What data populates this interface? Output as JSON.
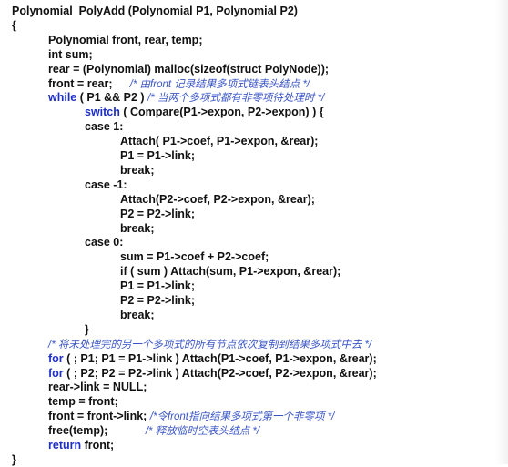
{
  "document": {
    "lines": [
      {
        "indent": 0,
        "parts": [
          {
            "text": "Polynomial  PolyAdd (Polynomial P1, Polynomial P2)",
            "kind": "code"
          }
        ]
      },
      {
        "indent": 0,
        "parts": [
          {
            "text": "{",
            "kind": "code"
          }
        ]
      },
      {
        "indent": 1,
        "parts": [
          {
            "text": "Polynomial front, rear, temp;",
            "kind": "code"
          }
        ]
      },
      {
        "indent": 1,
        "parts": [
          {
            "text": "int sum;",
            "kind": "code"
          }
        ]
      },
      {
        "indent": 1,
        "parts": [
          {
            "text": "rear = (Polynomial) malloc(sizeof(struct PolyNode));",
            "kind": "code"
          }
        ]
      },
      {
        "indent": 1,
        "parts": [
          {
            "text": "front = rear;",
            "kind": "code"
          },
          {
            "text": "      /* 由front 记录结果多项式链表头结点 */",
            "kind": "comment"
          }
        ]
      },
      {
        "indent": 1,
        "parts": [
          {
            "text": "while",
            "kind": "keyword"
          },
          {
            "text": " ( P1 && P2 ) ",
            "kind": "code"
          },
          {
            "text": "/* 当两个多项式都有非零项待处理时 */",
            "kind": "comment"
          }
        ]
      },
      {
        "indent": 2,
        "parts": [
          {
            "text": "switch",
            "kind": "keyword"
          },
          {
            "text": " ( Compare(P1->expon, P2->expon) ) {",
            "kind": "code"
          }
        ]
      },
      {
        "indent": 2,
        "parts": [
          {
            "text": "case 1:",
            "kind": "code"
          }
        ]
      },
      {
        "indent": 3,
        "parts": [
          {
            "text": "Attach( P1->coef, P1->expon, &rear);",
            "kind": "code"
          }
        ]
      },
      {
        "indent": 3,
        "parts": [
          {
            "text": "P1 = P1->link;",
            "kind": "code"
          }
        ]
      },
      {
        "indent": 3,
        "parts": [
          {
            "text": "break;",
            "kind": "code"
          }
        ]
      },
      {
        "indent": 2,
        "parts": [
          {
            "text": "case -1:",
            "kind": "code"
          }
        ]
      },
      {
        "indent": 3,
        "parts": [
          {
            "text": "Attach(P2->coef, P2->expon, &rear);",
            "kind": "code"
          }
        ]
      },
      {
        "indent": 3,
        "parts": [
          {
            "text": "P2 = P2->link;",
            "kind": "code"
          }
        ]
      },
      {
        "indent": 3,
        "parts": [
          {
            "text": "break;",
            "kind": "code"
          }
        ]
      },
      {
        "indent": 2,
        "parts": [
          {
            "text": "case 0:",
            "kind": "code"
          }
        ]
      },
      {
        "indent": 3,
        "parts": [
          {
            "text": "sum = P1->coef + P2->coef;",
            "kind": "code"
          }
        ]
      },
      {
        "indent": 3,
        "parts": [
          {
            "text": "if ( sum ) Attach(sum, P1->expon, &rear);",
            "kind": "code"
          }
        ]
      },
      {
        "indent": 3,
        "parts": [
          {
            "text": "P1 = P1->link;",
            "kind": "code"
          }
        ]
      },
      {
        "indent": 3,
        "parts": [
          {
            "text": "P2 = P2->link;",
            "kind": "code"
          }
        ]
      },
      {
        "indent": 3,
        "parts": [
          {
            "text": "break;",
            "kind": "code"
          }
        ]
      },
      {
        "indent": 2,
        "parts": [
          {
            "text": "}",
            "kind": "code"
          }
        ]
      },
      {
        "indent": 1,
        "parts": [
          {
            "text": "/* 将未处理完的另一个多项式的所有节点依次复制到结果多项式中去 */",
            "kind": "comment"
          }
        ]
      },
      {
        "indent": 1,
        "parts": [
          {
            "text": "for",
            "kind": "keyword"
          },
          {
            "text": " ( ; P1; P1 = P1->link ) Attach(P1->coef, P1->expon, &rear);",
            "kind": "code"
          }
        ]
      },
      {
        "indent": 1,
        "parts": [
          {
            "text": "for",
            "kind": "keyword"
          },
          {
            "text": " ( ; P2; P2 = P2->link ) Attach(P2->coef, P2->expon, &rear);",
            "kind": "code"
          }
        ]
      },
      {
        "indent": 1,
        "parts": [
          {
            "text": "rear->link = NULL;",
            "kind": "code"
          }
        ]
      },
      {
        "indent": 1,
        "parts": [
          {
            "text": "temp = front;",
            "kind": "code"
          }
        ]
      },
      {
        "indent": 1,
        "parts": [
          {
            "text": "front = front->link; ",
            "kind": "code"
          },
          {
            "text": "/*令front指向结果多项式第一个非零项 */",
            "kind": "comment"
          }
        ]
      },
      {
        "indent": 1,
        "parts": [
          {
            "text": "free(temp);",
            "kind": "code"
          },
          {
            "text": "             /* 释放临时空表头结点 */",
            "kind": "comment"
          }
        ]
      },
      {
        "indent": 1,
        "parts": [
          {
            "text": "return",
            "kind": "keyword"
          },
          {
            "text": " front;",
            "kind": "code"
          }
        ]
      },
      {
        "indent": 0,
        "parts": [
          {
            "text": "}",
            "kind": "code"
          }
        ]
      }
    ]
  },
  "colors": {
    "code": "#111111",
    "keyword": "#1e2fc4",
    "comment": "#3a56c6",
    "background": "#ffffff"
  }
}
